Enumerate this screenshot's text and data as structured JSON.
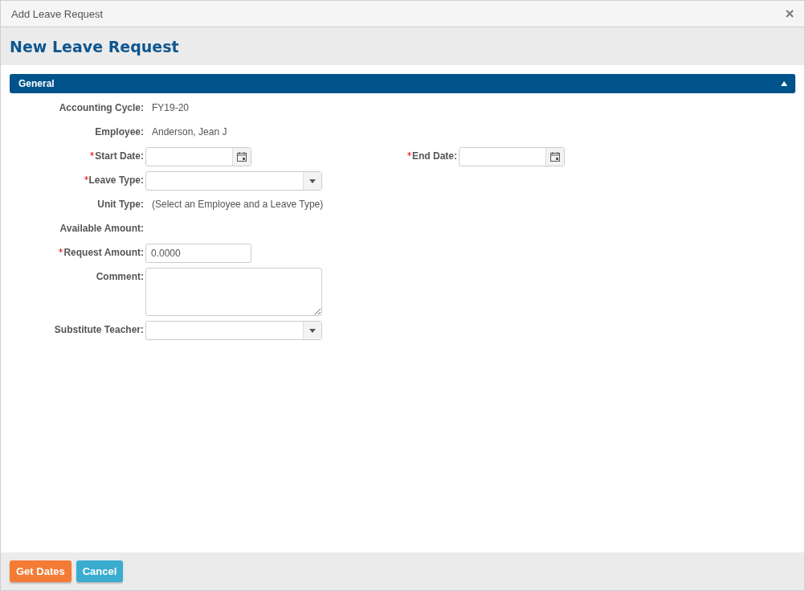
{
  "window": {
    "title": "Add Leave Request"
  },
  "heading": "New Leave Request",
  "section": {
    "title": "General",
    "expanded": true
  },
  "fields": [
    {
      "label": "Accounting Cycle:",
      "required": false,
      "kind": "text",
      "value": "FY19-20"
    },
    {
      "label": "Employee:",
      "required": false,
      "kind": "text",
      "value": "Anderson, Jean J"
    },
    {
      "label": "Start Date:",
      "required": true,
      "kind": "date",
      "paired": {
        "label": "End Date:",
        "required": true,
        "kind": "date"
      }
    },
    {
      "label": "Leave Type:",
      "required": true,
      "kind": "select"
    },
    {
      "label": "Unit Type:",
      "required": false,
      "kind": "text",
      "value": "(Select an Employee and a Leave Type)"
    },
    {
      "label": "Available Amount:",
      "required": false,
      "kind": "text"
    },
    {
      "label": "Request Amount:",
      "required": true,
      "kind": "input",
      "value": "0.0000"
    },
    {
      "label": "Comment:",
      "required": false,
      "kind": "textarea"
    },
    {
      "label": "Substitute Teacher:",
      "required": false,
      "kind": "select"
    }
  ],
  "buttons": [
    {
      "label": "Get Dates",
      "kind": "primary"
    },
    {
      "label": "Cancel",
      "kind": "secondary"
    }
  ]
}
